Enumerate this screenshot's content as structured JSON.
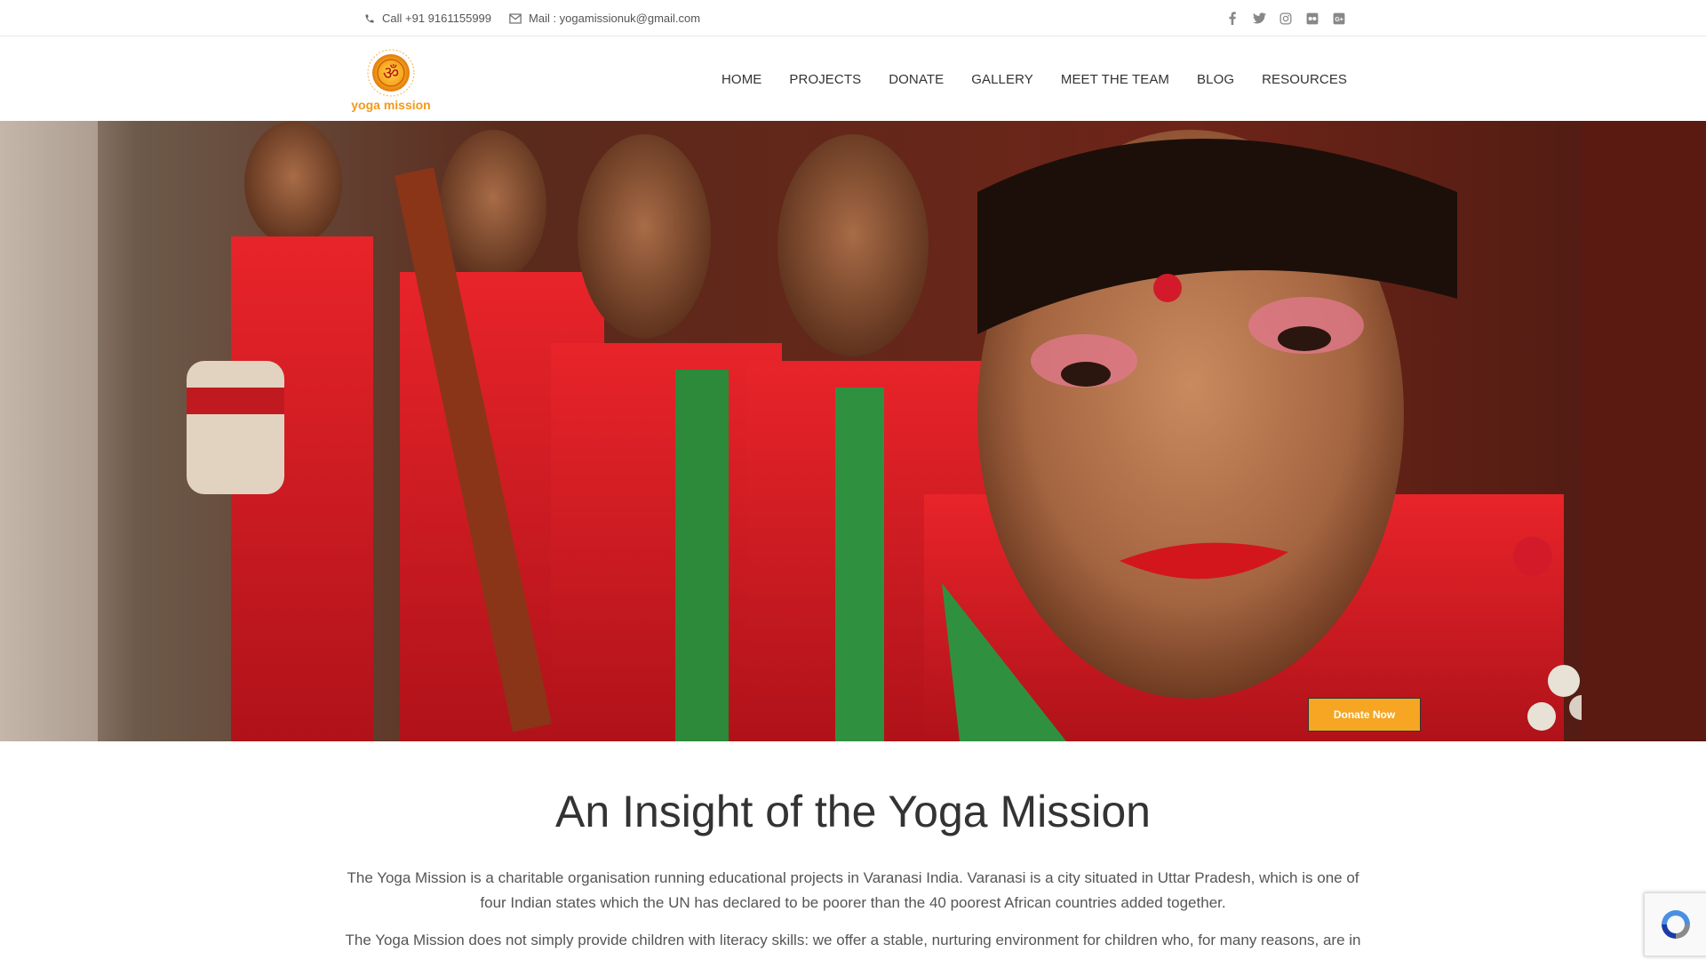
{
  "topbar": {
    "phone_text": "Call +91 9161155999",
    "mail_text": "Mail : yogamissionuk@gmail.com",
    "social_icons": [
      "facebook-icon",
      "twitter-icon",
      "instagram-icon",
      "flickr-icon",
      "google-plus-icon"
    ]
  },
  "header": {
    "logo_text": "yoga mission",
    "nav": [
      "HOME",
      "PROJECTS",
      "DONATE",
      "GALLERY",
      "MEET THE TEAM",
      "BLOG",
      "RESOURCES"
    ]
  },
  "hero": {
    "donate_label": "Donate Now"
  },
  "content": {
    "title": "An Insight of the Yoga Mission",
    "paragraph1": "The Yoga Mission is a charitable organisation running educational projects in Varanasi India. Varanasi is a city situated in Uttar Pradesh, which is one of four Indian states which the UN has declared to be poorer than the 40 poorest African countries added together.",
    "paragraph2": "The Yoga Mission does not simply provide children with literacy skills: we offer a stable, nurturing environment for children who, for many reasons, are in"
  },
  "colors": {
    "accent": "#f6a623",
    "logo_orange": "#f39a19"
  }
}
